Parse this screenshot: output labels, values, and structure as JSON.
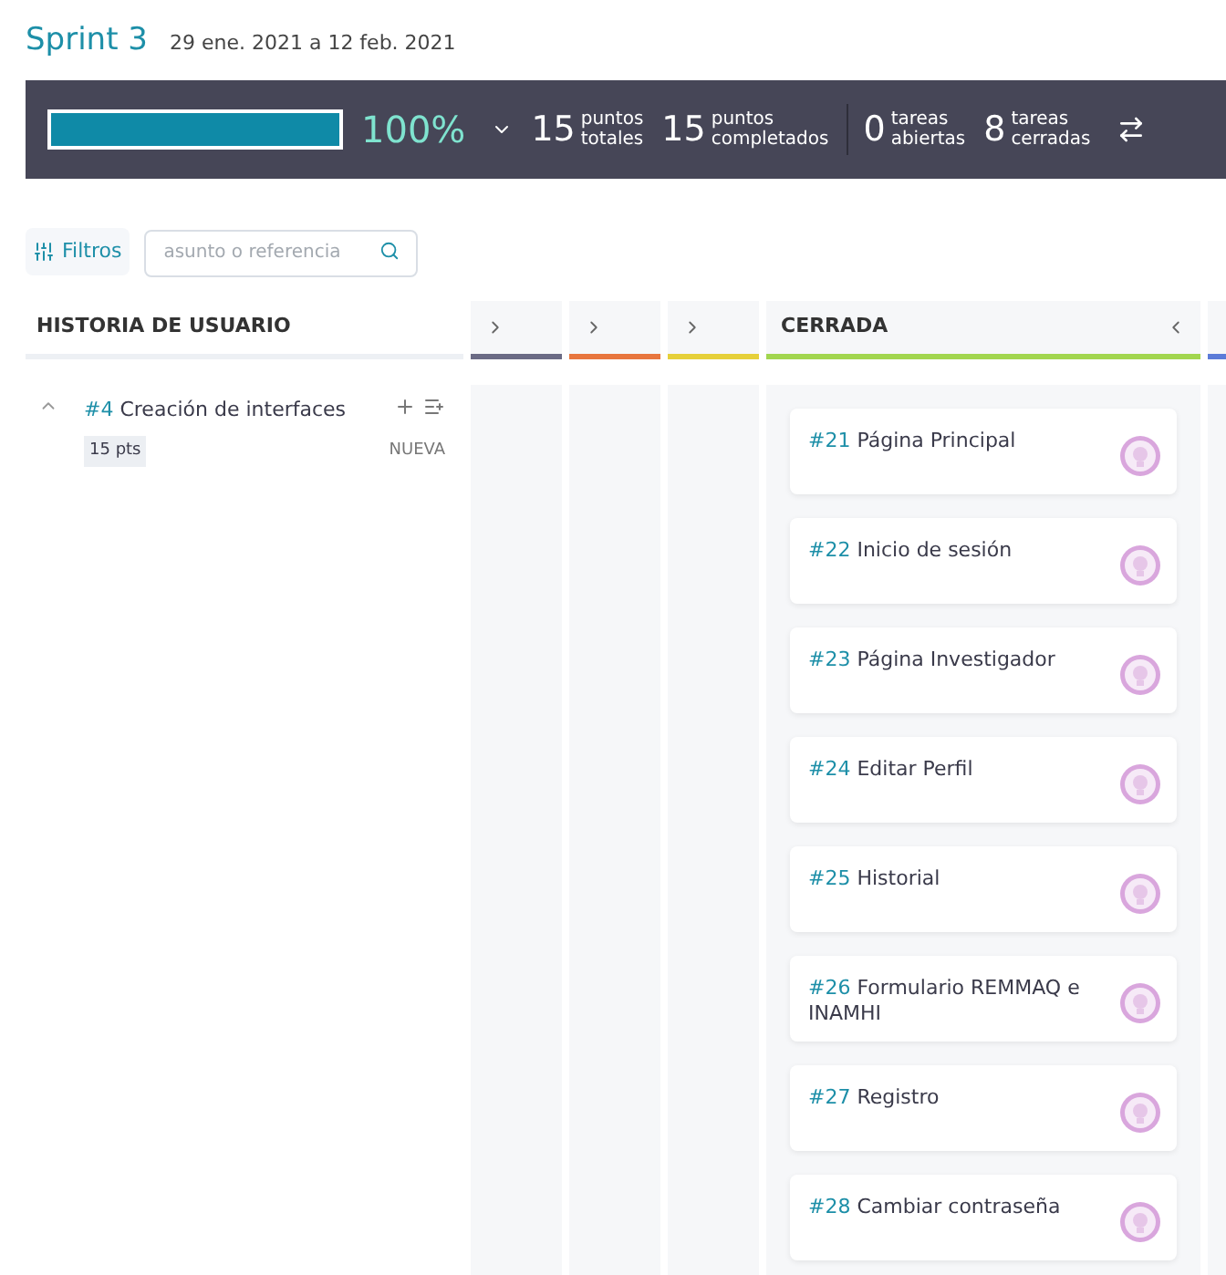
{
  "sprint": {
    "title": "Sprint 3",
    "dates": "29 ene. 2021 a 12 feb. 2021"
  },
  "summary": {
    "level": 1,
    "percent": "100%",
    "stats": [
      {
        "number": "15",
        "label_1": "puntos",
        "label_2": "totales"
      },
      {
        "number": "15",
        "label_1": "puntos",
        "label_2": "completados"
      },
      {
        "number": "0",
        "label_1": "tareas",
        "label_2": "abiertas"
      },
      {
        "number": "8",
        "label_1": "tareas",
        "label_2": "cerradas"
      }
    ]
  },
  "filters": {
    "button": "Filtros",
    "placeholder": "asunto o referencia"
  },
  "story_header": "HISTORIA DE USUARIO",
  "columns": [
    {
      "kind": "collapsed",
      "color": "#6b6b85"
    },
    {
      "kind": "collapsed",
      "color": "#e8763e"
    },
    {
      "kind": "collapsed",
      "color": "#e6d03a"
    },
    {
      "kind": "expanded",
      "title": "CERRADA",
      "color": "#a2d64f",
      "cards": [
        {
          "ref": "#21",
          "title": "Página Principal"
        },
        {
          "ref": "#22",
          "title": "Inicio de sesión"
        },
        {
          "ref": "#23",
          "title": "Página Investigador"
        },
        {
          "ref": "#24",
          "title": "Editar Perfil"
        },
        {
          "ref": "#25",
          "title": "Historial"
        },
        {
          "ref": "#26",
          "title": "Formulario REMMAQ e INAMHI"
        },
        {
          "ref": "#27",
          "title": "Registro"
        },
        {
          "ref": "#28",
          "title": "Cambiar contraseña"
        }
      ]
    },
    {
      "kind": "partial",
      "color": "#5b7bd8"
    }
  ],
  "story": {
    "expanded": true,
    "ref": "#4",
    "title": "Creación de interfaces",
    "points": "15 pts",
    "status": "NUEVA"
  }
}
